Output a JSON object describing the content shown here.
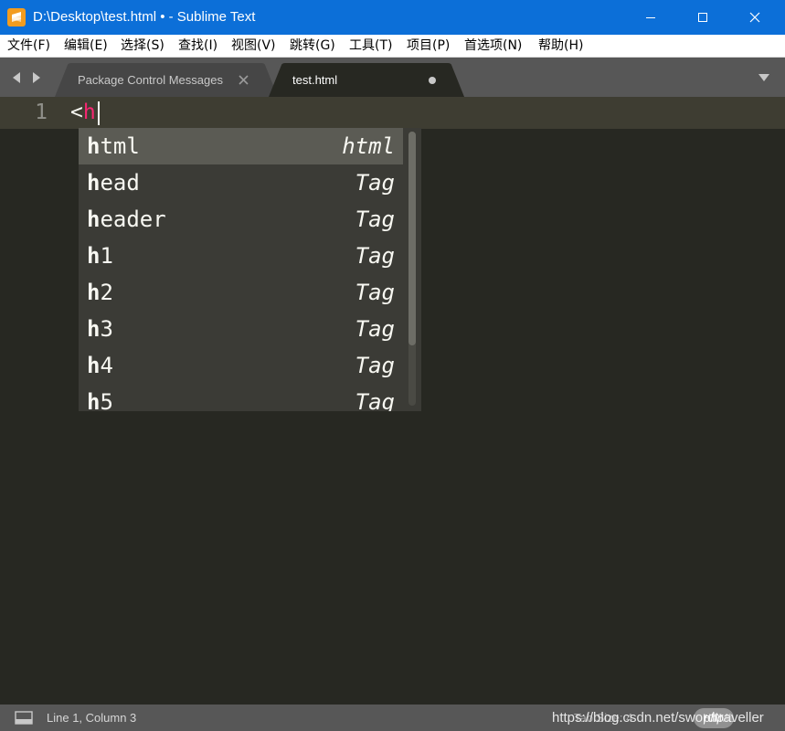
{
  "window": {
    "title": "D:\\Desktop\\test.html • - Sublime Text"
  },
  "menu": [
    "文件(F)",
    "编辑(E)",
    "选择(S)",
    "查找(I)",
    "视图(V)",
    "跳转(G)",
    "工具(T)",
    "项目(P)",
    "首选项(N)",
    "帮助(H)"
  ],
  "tabs": [
    {
      "label": "Package Control Messages",
      "active": false,
      "dirty": false
    },
    {
      "label": "test.html",
      "active": true,
      "dirty": true
    }
  ],
  "editor": {
    "line_number": "1",
    "code_bracket": "<",
    "code_tag": "h"
  },
  "autocomplete": {
    "typed_prefix": "h",
    "items": [
      {
        "rest": "tml",
        "annotation": "html",
        "selected": true
      },
      {
        "rest": "ead",
        "annotation": "Tag",
        "selected": false
      },
      {
        "rest": "eader",
        "annotation": "Tag",
        "selected": false
      },
      {
        "rest": "1",
        "annotation": "Tag",
        "selected": false
      },
      {
        "rest": "2",
        "annotation": "Tag",
        "selected": false
      },
      {
        "rest": "3",
        "annotation": "Tag",
        "selected": false
      },
      {
        "rest": "4",
        "annotation": "Tag",
        "selected": false
      },
      {
        "rest": "5",
        "annotation": "Tag",
        "selected": false
      }
    ]
  },
  "status": {
    "position": "Line 1, Column 3",
    "tab_size": "Tab Size: 4",
    "syntax": "HTML",
    "watermark": "https://blog.csdn.net/swordtraveller",
    "watermark_logo": "php"
  },
  "colors": {
    "titlebar": "#0c6fd8",
    "editor_bg": "#272822",
    "tag_color": "#f92672",
    "text": "#f8f8f2"
  },
  "icons": {
    "app": "sublime-text-logo-icon",
    "minimize": "minimize-icon",
    "maximize": "maximize-icon",
    "close": "close-icon"
  }
}
